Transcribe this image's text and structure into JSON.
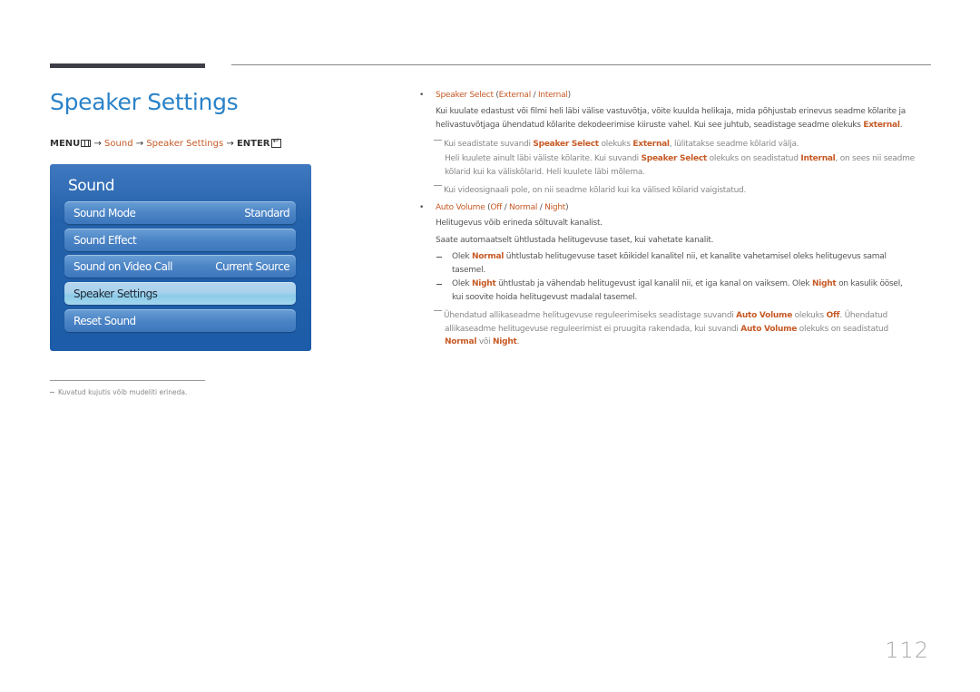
{
  "page": {
    "title": "Speaker Settings",
    "page_number": "112"
  },
  "menu_path": {
    "menu": "MENU",
    "arrow": "→",
    "sound": "Sound",
    "speaker_settings": "Speaker Settings",
    "enter": "ENTER"
  },
  "osd": {
    "title": "Sound",
    "items": [
      {
        "label": "Sound Mode",
        "value": "Standard"
      },
      {
        "label": "Sound Effect",
        "value": ""
      },
      {
        "label": "Sound on Video Call",
        "value": "Current Source"
      },
      {
        "label": "Speaker Settings",
        "value": "",
        "selected": true
      },
      {
        "label": "Reset Sound",
        "value": ""
      }
    ]
  },
  "footnote": "Kuvatud kujutis võib mudeliti erineda.",
  "sections": {
    "speaker_select": {
      "bullet": "•",
      "heading": "Speaker Select",
      "opt1": "External",
      "opt2": "Internal",
      "para1": "Kui kuulate edastust või filmi heli läbi välise vastuvõtja, võite kuulda helikaja, mida põhjustab erinevus seadme kõlarite ja",
      "para2a": "helivastuvõtjaga ühendatud kõlarite dekodeerimise kiiruste vahel. Kui see juhtub, seadistage seadme olekuks ",
      "para2b": "External",
      "para2c": ".",
      "note1a": "Kui seadistate suvandi ",
      "note1b": "Speaker Select",
      "note1c": " olekuks ",
      "note1d": "External",
      "note1e": ", lülitatakse seadme kõlarid välja.",
      "note2a": "Heli kuulete ainult läbi väliste kõlarite. Kui suvandi ",
      "note2b": "Speaker Select",
      "note2c": " olekuks on seadistatud ",
      "note2d": "Internal",
      "note2e": ", on sees nii seadme",
      "note2f": "kõlarid kui ka väliskõlarid. Heli kuulete läbi mõlema.",
      "note3": "Kui videosignaali pole, on nii seadme kõlarid kui ka välised kõlarid vaigistatud."
    },
    "auto_volume": {
      "bullet": "•",
      "heading": "Auto Volume",
      "opt1": "Off",
      "opt2": "Normal",
      "opt3": "Night",
      "line1": "Helitugevus võib erineda sõltuvalt kanalist.",
      "line2": "Saate automaatselt ühtlustada helitugevuse taset, kui vahetate kanalit.",
      "d1a": "Olek ",
      "d1b": "Normal",
      "d1c": " ühtlustab helitugevuse taset kõikidel kanalitel nii, et kanalite vahetamisel oleks helitugevus samal",
      "d1d": "tasemel.",
      "d2a": "Olek ",
      "d2b": "Night",
      "d2c": " ühtlustab ja vähendab helitugevust igal kanalil nii, et iga kanal on vaiksem. Olek ",
      "d2d": "Night",
      "d2e": " on kasulik öösel,",
      "d2f": "kui soovite hoida helitugevust madalal tasemel.",
      "n1a": "Ühendatud allikaseadme helitugevuse reguleerimiseks seadistage suvandi ",
      "n1b": "Auto Volume",
      "n1c": " olekuks ",
      "n1d": "Off",
      "n1e": ". Ühendatud",
      "n2a": "allikaseadme helitugevuse reguleerimist ei pruugita rakendada, kui suvandi ",
      "n2b": "Auto Volume",
      "n2c": " olekuks on seadistatud",
      "n3a": "Normal",
      "n3b": " või ",
      "n3c": "Night",
      "n3d": "."
    }
  },
  "colors": {
    "title_blue": "#2a82c8",
    "highlight_orange": "#c65a26",
    "osd_blue": "#1c5ca8"
  }
}
